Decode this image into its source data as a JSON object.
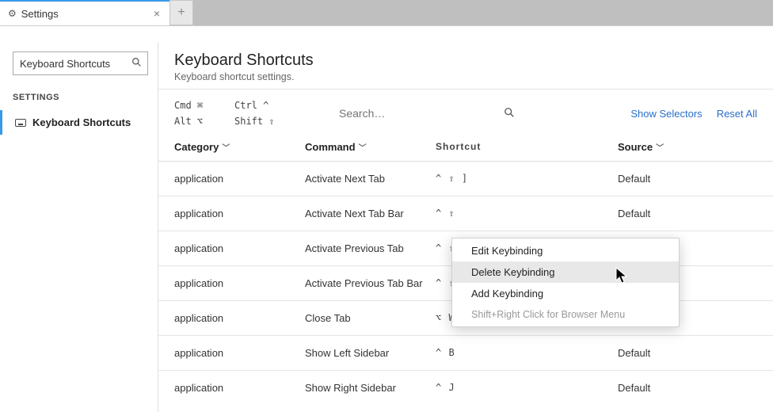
{
  "tab": {
    "title": "Settings"
  },
  "sidebar": {
    "search_value": "Keyboard Shortcuts",
    "header": "SETTINGS",
    "item": "Keyboard Shortcuts"
  },
  "page": {
    "title": "Keyboard Shortcuts",
    "subtitle": "Keyboard shortcut settings."
  },
  "legend": {
    "cmd": "Cmd ⌘",
    "ctrl": "Ctrl  ^",
    "alt": "Alt ⌥",
    "shift": "Shift ⇧"
  },
  "search": {
    "placeholder": "Search…"
  },
  "links": {
    "show_selectors": "Show Selectors",
    "reset_all": "Reset All"
  },
  "columns": {
    "category": "Category",
    "command": "Command",
    "shortcut": "Shortcut",
    "source": "Source"
  },
  "rows": [
    {
      "category": "application",
      "command": "Activate Next Tab",
      "shortcut": "^ ⇧ ]",
      "source": "Default"
    },
    {
      "category": "application",
      "command": "Activate Next Tab Bar",
      "shortcut": "^ ⇧",
      "source": "Default"
    },
    {
      "category": "application",
      "command": "Activate Previous Tab",
      "shortcut": "^ ⇧",
      "source": ""
    },
    {
      "category": "application",
      "command": "Activate Previous Tab Bar",
      "shortcut": "^ ⇧",
      "source": ""
    },
    {
      "category": "application",
      "command": "Close Tab",
      "shortcut": "⌥ W",
      "source": "Default"
    },
    {
      "category": "application",
      "command": "Show Left Sidebar",
      "shortcut": "^ B",
      "source": "Default"
    },
    {
      "category": "application",
      "command": "Show Right Sidebar",
      "shortcut": "^ J",
      "source": "Default"
    }
  ],
  "context_menu": {
    "edit": "Edit Keybinding",
    "delete": "Delete Keybinding",
    "add": "Add Keybinding",
    "hint": "Shift+Right Click for Browser Menu"
  },
  "colors": {
    "accent": "#3a99e9",
    "link": "#2a6fc9"
  }
}
